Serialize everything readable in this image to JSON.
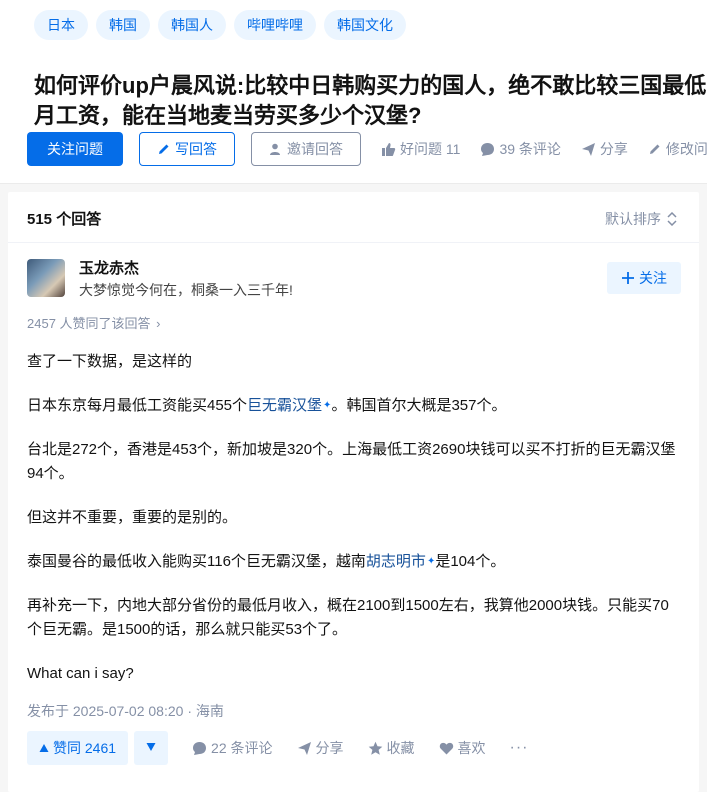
{
  "topics": [
    "日本",
    "韩国",
    "韩国人",
    "哔哩哔哩",
    "韩国文化"
  ],
  "question": {
    "title_line1": "如何评价up户晨风说:比较中日韩购买力的国人，绝不敢比较三国最低",
    "title_line2": "月工资，能在当地麦当劳买多少个汉堡?"
  },
  "actions": {
    "follow_question": "关注问题",
    "write_answer": "写回答",
    "invite_answer": "邀请回答",
    "good_question": "好问题 11",
    "comments": "39 条评论",
    "share": "分享",
    "edit": "修改问"
  },
  "answers_header": {
    "count": "515 个回答",
    "sort": "默认排序"
  },
  "author": {
    "name": "玉龙赤杰",
    "bio": "大梦惊觉今何在，桐桑一入三千年!",
    "follow": "关注"
  },
  "voters": "2457 人赞同了该回答",
  "content": {
    "p1": "查了一下数据，是这样的",
    "p2_pre": "日本东京每月最低工资能买455个",
    "p2_link": "巨无霸汉堡",
    "p2_post": "。韩国首尔大概是357个。",
    "p3": "台北是272个，香港是453个，新加坡是320个。上海最低工资2690块钱可以买不打折的巨无霸汉堡94个。",
    "p4": "但这并不重要，重要的是别的。",
    "p5_pre": "泰国曼谷的最低收入能购买116个巨无霸汉堡，越南",
    "p5_link": "胡志明市",
    "p5_post": "是104个。",
    "p6": "再补充一下，内地大部分省份的最低月收入，概在2100到1500左右，我算他2000块钱。只能买70个巨无霸。是1500的话，那么就只能买53个了。",
    "p7": "What can i say?"
  },
  "published": "发布于 2025-07-02 08:20 · 海南",
  "bottom": {
    "upvote": "赞同 2461",
    "comments": "22 条评论",
    "share": "分享",
    "collect": "收藏",
    "like": "喜欢"
  },
  "colors": {
    "brand": "#056de8",
    "muted": "#8590a6",
    "link": "#175199",
    "tag_bg": "#ebf5ff"
  }
}
